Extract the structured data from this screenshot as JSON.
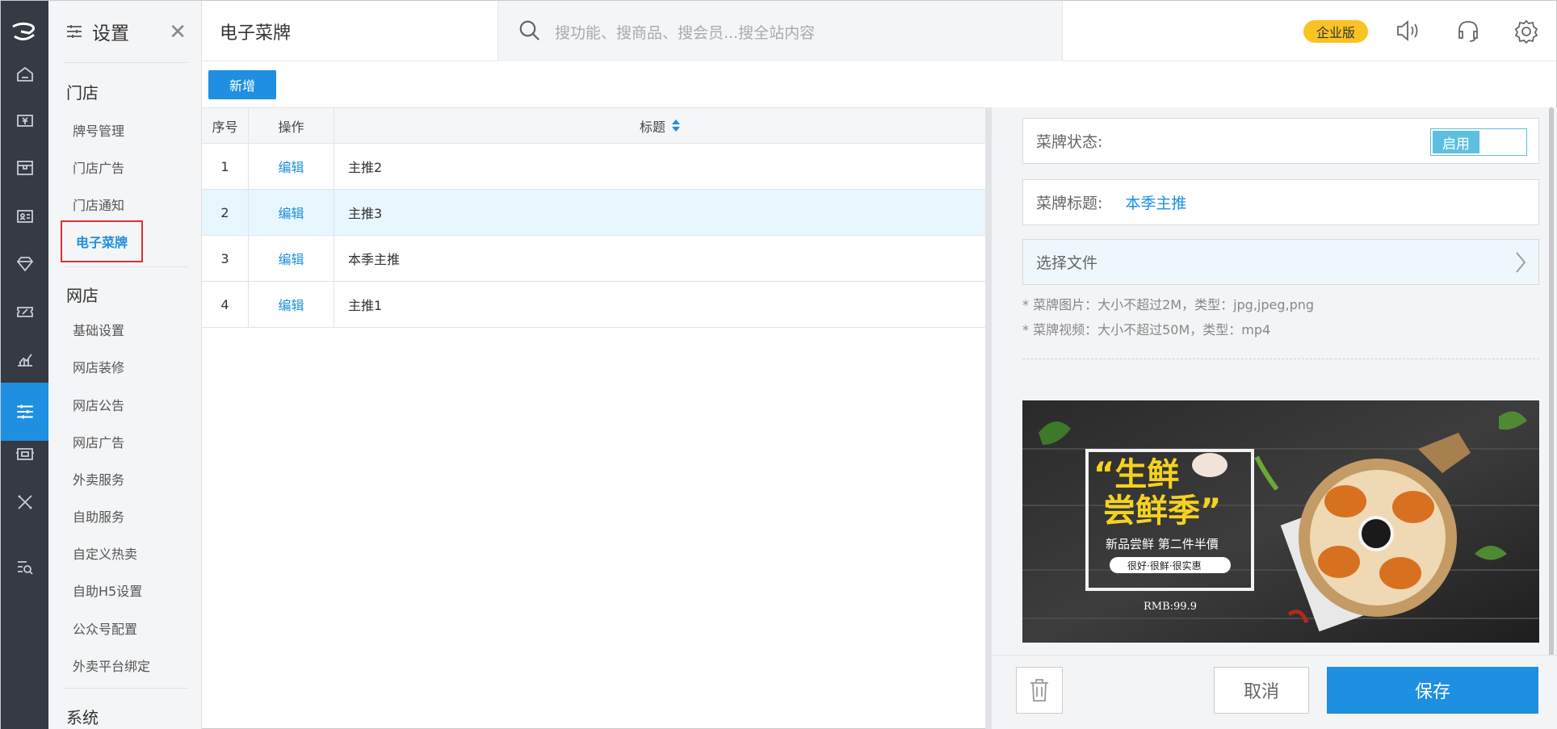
{
  "sidebar": {
    "title": "设置",
    "sections": [
      {
        "label": "门店",
        "items": [
          "牌号管理",
          "门店广告",
          "门店通知",
          "电子菜牌"
        ]
      },
      {
        "label": "网店",
        "items": [
          "基础设置",
          "网店装修",
          "网店公告",
          "网店广告",
          "外卖服务",
          "自助服务",
          "自定义热卖",
          "自助H5设置",
          "公众号配置",
          "外卖平台绑定"
        ]
      },
      {
        "label": "系统"
      }
    ]
  },
  "header": {
    "page_title": "电子菜牌",
    "search_placeholder": "搜功能、搜商品、搜会员...搜全站内容",
    "edition_badge": "企业版"
  },
  "toolbar": {
    "add_label": "新增"
  },
  "table": {
    "columns": [
      "序号",
      "操作",
      "标题"
    ],
    "rows": [
      {
        "no": "1",
        "action": "编辑",
        "title": "主推2"
      },
      {
        "no": "2",
        "action": "编辑",
        "title": "主推3"
      },
      {
        "no": "3",
        "action": "编辑",
        "title": "本季主推"
      },
      {
        "no": "4",
        "action": "编辑",
        "title": "主推1"
      }
    ]
  },
  "form": {
    "status_label": "菜牌状态:",
    "status_value": "启用",
    "title_label": "菜牌标题:",
    "title_value": "本季主推",
    "file_label": "选择文件",
    "note_image": "* 菜牌图片：大小不超过2M，类型：jpg,jpeg,png",
    "note_video": "* 菜牌视频：大小不超过50M，类型：mp4"
  },
  "banner": {
    "headline_1": "“生鲜",
    "headline_2": "尝鲜季”",
    "promo": "新品尝鲜 第二件半價",
    "tagline": "很好·很鲜·很实惠",
    "price": "RMB:99.9"
  },
  "footer": {
    "cancel_label": "取消",
    "save_label": "保存"
  },
  "colors": {
    "accent": "#1e8fe1",
    "rail": "#363a42",
    "badge": "#f8c323",
    "toggle": "#5ec0e0"
  }
}
